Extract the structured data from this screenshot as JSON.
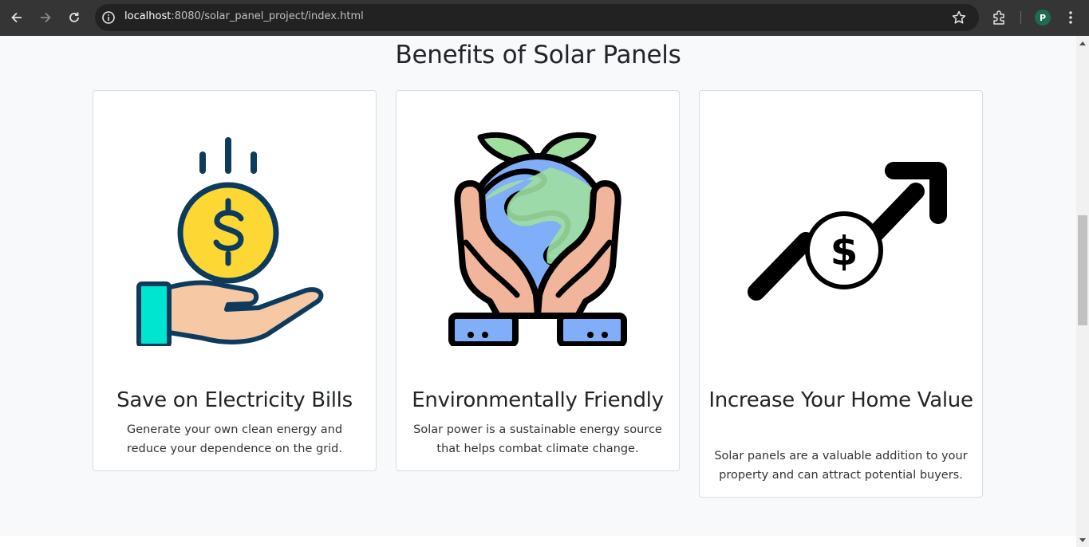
{
  "browser": {
    "url_host": "localhost",
    "url_rest": ":8080/solar_panel_project/index.html",
    "profile_initial": "P",
    "icons": [
      "back-icon",
      "forward-icon",
      "reload-icon",
      "site-info-icon",
      "bookmark-star-icon",
      "extensions-icon",
      "menu-icon"
    ]
  },
  "page": {
    "section_title": "Benefits of Solar Panels",
    "cards": [
      {
        "icon": "hand-coin-icon",
        "title": "Save on Electricity Bills",
        "text": "Generate your own clean energy and reduce your dependence on the grid."
      },
      {
        "icon": "hands-earth-icon",
        "title": "Environmentally Friendly",
        "text": "Solar power is a sustainable energy source that helps combat climate change."
      },
      {
        "icon": "growth-arrow-dollar-icon",
        "title": "Increase Your Home Value",
        "text": "Solar panels are a valuable addition to your property and can attract potential buyers."
      }
    ]
  },
  "colors": {
    "chrome_bar": "#353535",
    "omnibox": "#222222",
    "page_bg": "#f8f9fa",
    "coin_yellow": "#fdd835",
    "outline_navy": "#0d3b5e",
    "cuff_teal": "#00e5d0",
    "skin": "#f6c9a4",
    "earth_blue": "#80aef8",
    "earth_green": "#9edfa0",
    "hand_salmon": "#f0b59a"
  }
}
